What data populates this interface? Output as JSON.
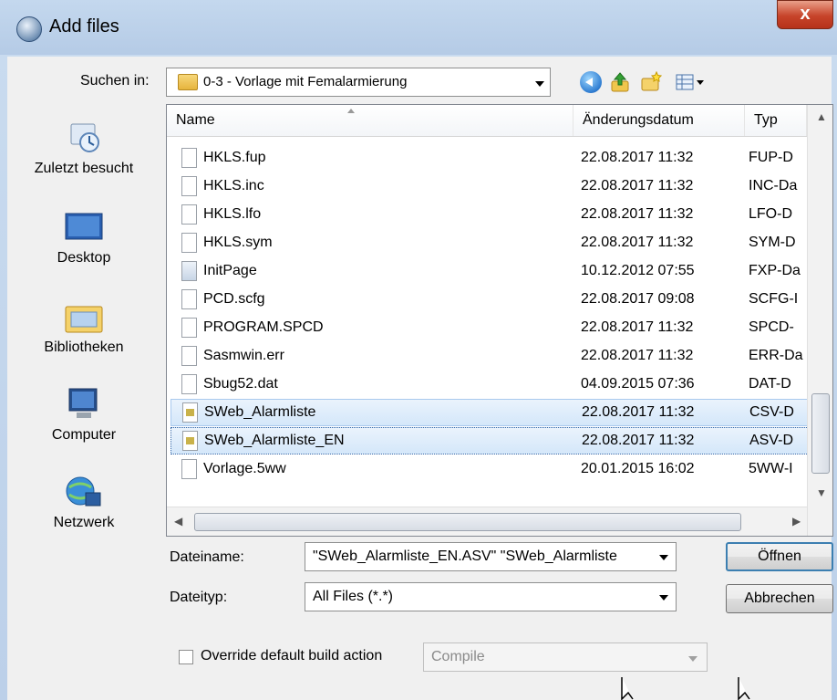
{
  "window": {
    "title": "Add files",
    "close_glyph": "x"
  },
  "lookin": {
    "label": "Suchen in:",
    "value": "0-3 - Vorlage mit Femalarmierung"
  },
  "toolbar": {
    "icons": [
      "back-icon",
      "up-folder-icon",
      "new-folder-icon",
      "views-menu-icon"
    ]
  },
  "places": [
    {
      "label": "Zuletzt besucht",
      "icon": "recent-places-icon"
    },
    {
      "label": "Desktop",
      "icon": "desktop-icon"
    },
    {
      "label": "Bibliotheken",
      "icon": "libraries-icon"
    },
    {
      "label": "Computer",
      "icon": "computer-icon"
    },
    {
      "label": "Netzwerk",
      "icon": "network-icon"
    }
  ],
  "columns": {
    "name": "Name",
    "date": "Änderungsdatum",
    "type": "Typ"
  },
  "files": [
    {
      "name": "HKLS.fup",
      "date": "22.08.2017 11:32",
      "type": "FUP-D"
    },
    {
      "name": "HKLS.inc",
      "date": "22.08.2017 11:32",
      "type": "INC-Da"
    },
    {
      "name": "HKLS.lfo",
      "date": "22.08.2017 11:32",
      "type": "LFO-D"
    },
    {
      "name": "HKLS.sym",
      "date": "22.08.2017 11:32",
      "type": "SYM-D"
    },
    {
      "name": "InitPage",
      "date": "10.12.2012 07:55",
      "type": "FXP-Da"
    },
    {
      "name": "PCD.scfg",
      "date": "22.08.2017 09:08",
      "type": "SCFG-I"
    },
    {
      "name": "PROGRAM.SPCD",
      "date": "22.08.2017 11:32",
      "type": "SPCD-"
    },
    {
      "name": "Sasmwin.err",
      "date": "22.08.2017 11:32",
      "type": "ERR-Da"
    },
    {
      "name": "Sbug52.dat",
      "date": "04.09.2015 07:36",
      "type": "DAT-D"
    },
    {
      "name": "SWeb_Alarmliste",
      "date": "22.08.2017 11:32",
      "type": "CSV-D"
    },
    {
      "name": "SWeb_Alarmliste_EN",
      "date": "22.08.2017 11:32",
      "type": "ASV-D"
    },
    {
      "name": "Vorlage.5ww",
      "date": "20.01.2015 16:02",
      "type": "5WW-I"
    }
  ],
  "filename": {
    "label": "Dateiname:",
    "value": "\"SWeb_Alarmliste_EN.ASV\" \"SWeb_Alarmliste"
  },
  "filetype": {
    "label": "Dateityp:",
    "value": "All Files (*.*)"
  },
  "buttons": {
    "open": "Öffnen",
    "cancel": "Abbrechen"
  },
  "override": {
    "label": "Override default build action",
    "value": "Compile",
    "checked": false
  },
  "colors": {
    "selection": "#d4e7fa",
    "selection_border": "#a8c9ee",
    "close": "#c7442a",
    "default_button_border": "#3c7fb1"
  }
}
